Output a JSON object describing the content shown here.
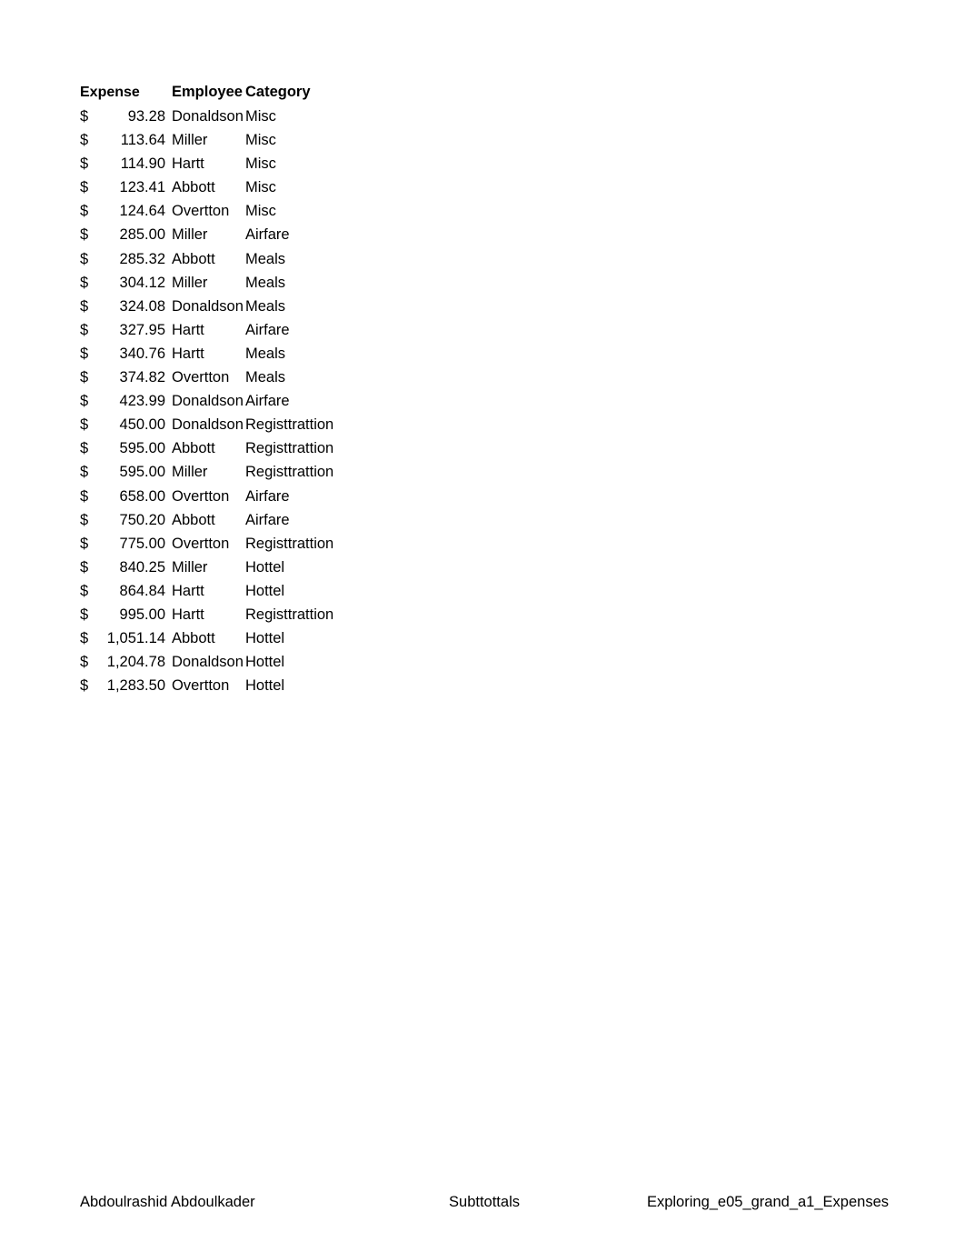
{
  "sheet": {
    "columns": [
      {
        "key": "expense",
        "label": "Expense"
      },
      {
        "key": "employee",
        "label": "Employee"
      },
      {
        "key": "category",
        "label": "Category"
      }
    ],
    "currency_symbol": "$",
    "rows": [
      {
        "expense": "93.28",
        "employee": "Donaldson",
        "category": "Misc"
      },
      {
        "expense": "113.64",
        "employee": "Miller",
        "category": "Misc"
      },
      {
        "expense": "114.90",
        "employee": "Hartt",
        "category": "Misc"
      },
      {
        "expense": "123.41",
        "employee": "Abbott",
        "category": "Misc"
      },
      {
        "expense": "124.64",
        "employee": "Overtton",
        "category": "Misc"
      },
      {
        "expense": "285.00",
        "employee": "Miller",
        "category": "Airfare"
      },
      {
        "expense": "285.32",
        "employee": "Abbott",
        "category": "Meals"
      },
      {
        "expense": "304.12",
        "employee": "Miller",
        "category": "Meals"
      },
      {
        "expense": "324.08",
        "employee": "Donaldson",
        "category": "Meals"
      },
      {
        "expense": "327.95",
        "employee": "Hartt",
        "category": "Airfare"
      },
      {
        "expense": "340.76",
        "employee": "Hartt",
        "category": "Meals"
      },
      {
        "expense": "374.82",
        "employee": "Overtton",
        "category": "Meals"
      },
      {
        "expense": "423.99",
        "employee": "Donaldson",
        "category": "Airfare"
      },
      {
        "expense": "450.00",
        "employee": "Donaldson",
        "category": "Registtrattion"
      },
      {
        "expense": "595.00",
        "employee": "Abbott",
        "category": "Registtrattion"
      },
      {
        "expense": "595.00",
        "employee": "Miller",
        "category": "Registtrattion"
      },
      {
        "expense": "658.00",
        "employee": "Overtton",
        "category": "Airfare"
      },
      {
        "expense": "750.20",
        "employee": "Abbott",
        "category": "Airfare"
      },
      {
        "expense": "775.00",
        "employee": "Overtton",
        "category": "Registtrattion"
      },
      {
        "expense": "840.25",
        "employee": "Miller",
        "category": "Hottel"
      },
      {
        "expense": "864.84",
        "employee": "Hartt",
        "category": "Hottel"
      },
      {
        "expense": "995.00",
        "employee": "Hartt",
        "category": "Registtrattion"
      },
      {
        "expense": "1,051.14",
        "employee": "Abbott",
        "category": "Hottel"
      },
      {
        "expense": "1,204.78",
        "employee": "Donaldson",
        "category": "Hottel"
      },
      {
        "expense": "1,283.50",
        "employee": "Overtton",
        "category": "Hottel"
      }
    ]
  },
  "footer": {
    "left": "Abdoulrashid Abdoulkader",
    "center": "Subttottals",
    "right": "Exploring_e05_grand_a1_Expenses"
  }
}
